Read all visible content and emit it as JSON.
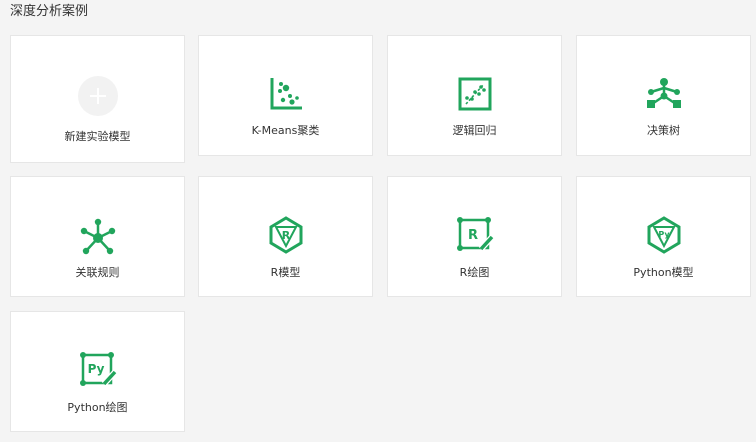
{
  "section": {
    "title": "深度分析案例"
  },
  "theme": {
    "accent": "#21a55c",
    "card_bg": "#ffffff",
    "card_border": "#e6e6e6",
    "page_bg": "#f4f4f4",
    "plus_circle_bg": "#f2f2f2"
  },
  "cards": [
    {
      "label": "新建实验模型",
      "icon": "plus-icon"
    },
    {
      "label": "K-Means聚类",
      "icon": "scatter-cluster-icon"
    },
    {
      "label": "逻辑回归",
      "icon": "regression-icon"
    },
    {
      "label": "决策树",
      "icon": "tree-icon"
    },
    {
      "label": "关联规则",
      "icon": "network-icon"
    },
    {
      "label": "R模型",
      "icon": "r-model-icon"
    },
    {
      "label": "R绘图",
      "icon": "r-plot-icon"
    },
    {
      "label": "Python模型",
      "icon": "python-model-icon"
    },
    {
      "label": "Python绘图",
      "icon": "python-plot-icon"
    }
  ]
}
